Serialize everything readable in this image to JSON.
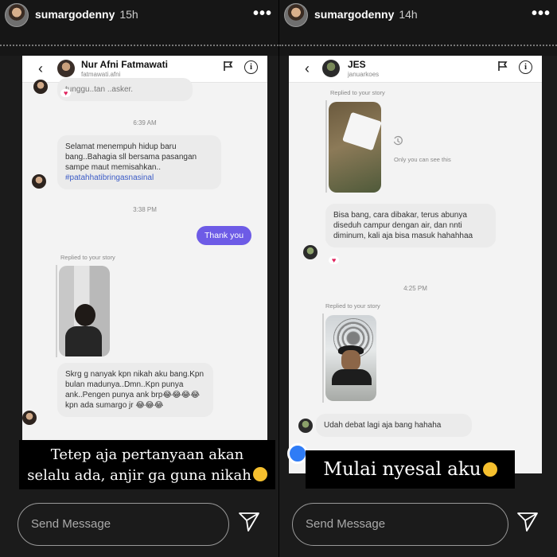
{
  "stories": [
    {
      "username": "sumargodenny",
      "time": "15h",
      "more": "•••",
      "dm": {
        "back": "‹",
        "name": "Nur Afni Fatmawati",
        "handle": "fatmawati.afni",
        "info": "i",
        "partial_top": "tunggu..tan ..asker.",
        "ts1": "6:39 AM",
        "msg1": "Selamat menempuh hidup baru bang..Bahagia sll bersama pasangan sampe maut memisahkan..",
        "hashtag": "#patahhatibringasnasinal",
        "ts2": "3:38 PM",
        "mine": "Thank you",
        "replied": "Replied to your story",
        "msg2": "Skrg g nanyak kpn nikah aku bang.Kpn bulan madunya..Dmn..Kpn punya ank..Pengen punya ank brp😂😂😂😂kpn ada sumargo jr 😂😂😂"
      },
      "caption_line1": "Tetep aja pertanyaan akan",
      "caption_line2": "selalu ada, anjir ga guna nikah",
      "send_placeholder": "Send Message"
    },
    {
      "username": "sumargodenny",
      "time": "14h",
      "more": "•••",
      "dm": {
        "back": "‹",
        "name": "JES",
        "handle": "januarkoes",
        "info": "i",
        "replied1": "Replied to your story",
        "only_you": "Only you can see this",
        "msg1": "Bisa bang, cara dibakar, terus abunya diseduh campur dengan air, dan nnti diminum, kali aja bisa masuk hahahhaa",
        "ts1": "4:25 PM",
        "replied2": "Replied to your story",
        "msg2": "Udah debat lagi aja bang hahaha"
      },
      "caption": "Mulai nyesal aku",
      "send_placeholder": "Send Message"
    }
  ]
}
